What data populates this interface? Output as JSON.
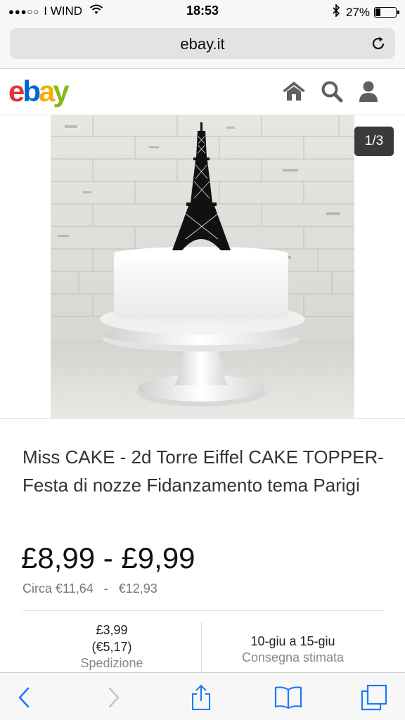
{
  "status_bar": {
    "signal_dots": "●●●○○",
    "carrier": "I WIND",
    "time": "18:53",
    "battery_percent_label": "27%",
    "battery_level": 0.27,
    "icons": [
      "wifi-icon",
      "bluetooth-icon",
      "battery-icon"
    ]
  },
  "browser": {
    "url": "ebay.it",
    "reload_icon": "reload-icon"
  },
  "header": {
    "logo_letters": [
      "e",
      "b",
      "a",
      "y"
    ],
    "logo_colors": [
      "#e53238",
      "#0064d2",
      "#f5af02",
      "#86b817"
    ],
    "icons": [
      "home-icon",
      "search-icon",
      "user-icon"
    ]
  },
  "gallery": {
    "counter": "1/3"
  },
  "product": {
    "title": "Miss CAKE - 2d Torre Eiffel CAKE TOPPER-Festa di nozze Fidanzamento tema Parigi",
    "price": "£8,99 - £9,99",
    "approx_prefix": "Circa €11,64",
    "approx_sep": "-",
    "approx_high": "€12,93"
  },
  "info": {
    "shipping_value": "£3,99",
    "shipping_converted": "(€5,17)",
    "shipping_label": "Spedizione",
    "delivery_value": "10-giu a 15-giu",
    "delivery_label": "Consegna stimata"
  },
  "toolbar": {
    "icons": [
      "back-icon",
      "forward-icon",
      "share-icon",
      "bookmarks-icon",
      "tabs-icon"
    ]
  },
  "colors": {
    "accent_blue": "#1a7cf5",
    "disabled_gray": "#c4c4c4"
  }
}
